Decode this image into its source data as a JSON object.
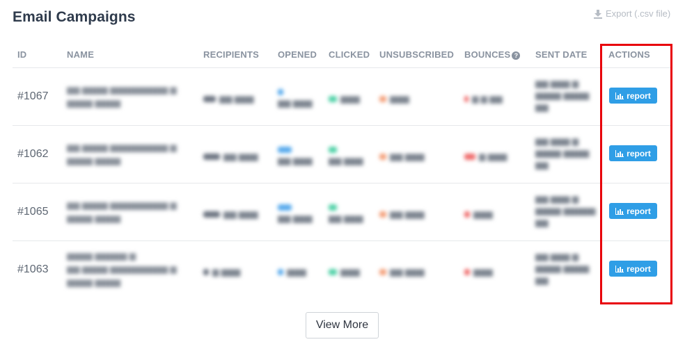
{
  "page": {
    "title": "Email Campaigns",
    "export_label": "Export (.csv file)",
    "export_icon": "download-icon"
  },
  "columns": {
    "id": "ID",
    "name": "NAME",
    "recipients": "RECIPIENTS",
    "opened": "OPENED",
    "clicked": "CLICKED",
    "unsubscribed": "UNSUBSCRIBED",
    "bounces": "BOUNCES",
    "sent_date": "SENT DATE",
    "actions": "ACTIONS"
  },
  "bounces_help_icon": "question-circle-icon",
  "rows": [
    {
      "id": "#1067",
      "report_label": "report"
    },
    {
      "id": "#1062",
      "report_label": "report"
    },
    {
      "id": "#1065",
      "report_label": "report"
    },
    {
      "id": "#1063",
      "report_label": "report"
    }
  ],
  "report_icon": "bar-chart-icon",
  "view_more_label": "View More",
  "colors": {
    "report_button": "#2f9ee6",
    "highlight_border": "#e8000b",
    "title": "#2f3b4c",
    "header_text": "#8a93a0"
  }
}
